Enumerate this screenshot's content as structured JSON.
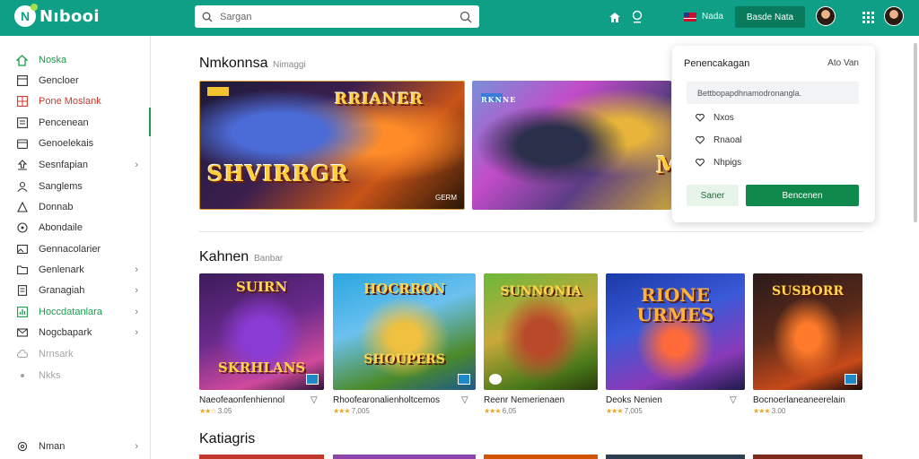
{
  "header": {
    "logo_text": "Nıbooi",
    "logo_letter": "N",
    "search_placeholder": "Sargan",
    "notif_label": "",
    "flag_text": "Nada",
    "cta_label": "Basde Nata"
  },
  "sidebar": {
    "items": [
      {
        "label": "Noska",
        "icon": "home-icon",
        "style": "green"
      },
      {
        "label": "Gencloer",
        "icon": "grid-icon",
        "style": ""
      },
      {
        "label": "Pone Moslank",
        "icon": "table-icon",
        "style": "red"
      },
      {
        "label": "Pencenean",
        "icon": "list-icon",
        "style": ""
      },
      {
        "label": "Genoelekais",
        "icon": "box-icon",
        "style": ""
      },
      {
        "label": "Sesnfapian",
        "icon": "upload-icon",
        "style": "",
        "chevron": true
      },
      {
        "label": "Sanglems",
        "icon": "users-icon",
        "style": ""
      },
      {
        "label": "Donnab",
        "icon": "triangle-icon",
        "style": ""
      },
      {
        "label": "Abondaile",
        "icon": "circle-icon",
        "style": ""
      },
      {
        "label": "Gennacolarier",
        "icon": "image-icon",
        "style": ""
      },
      {
        "label": "Genlenark",
        "icon": "folder-icon",
        "style": "",
        "chevron": true
      },
      {
        "label": "Granagiah",
        "icon": "doc-icon",
        "style": "",
        "chevron": true
      },
      {
        "label": "Hoccdatanlara",
        "icon": "chart-icon",
        "style": "green",
        "chevron": true
      },
      {
        "label": "Nogcbapark",
        "icon": "mail-icon",
        "style": "",
        "chevron": true
      },
      {
        "label": "Nrnsark",
        "icon": "cloud-icon",
        "style": "faded"
      },
      {
        "label": "Nkks",
        "icon": "dot-icon",
        "style": "faded"
      },
      {
        "label": "Nman",
        "icon": "settings-icon",
        "style": "",
        "chevron": true
      }
    ]
  },
  "sections": {
    "featured_title": "Nmkonnsa",
    "featured_sub": "Nimaggi",
    "recommended_title": "Kahnen",
    "recommended_sub": "Banbar",
    "categories_title": "Katiagris"
  },
  "banners": [
    {
      "title": "SHVIRRGR",
      "subtitle": "RRIANER",
      "badge": "GERM"
    },
    {
      "title": "M",
      "subtitle": "RKNNE"
    }
  ],
  "cards": [
    {
      "art_top": "SUIRN",
      "art_bottom": "SKRHLANS",
      "name": "Naeofeaonfenhiennol",
      "rating": "★★☆",
      "meta": "3.05",
      "has_chevron": true
    },
    {
      "art_top": "HOCRRON",
      "art_bottom": "SHOUPERS",
      "name": "Rhoofearonalienholtcemos",
      "rating": "★★★",
      "meta": "7,005",
      "has_chevron": true
    },
    {
      "art_top": "SUNNONIA",
      "art_bottom": "",
      "name": "Reenr Nemerienaen",
      "rating": "★★★",
      "meta": "6,05",
      "has_chevron": false
    },
    {
      "art_top": "RIONE",
      "art_bottom": "URMES",
      "name": "Deoks Nenien",
      "rating": "★★★",
      "meta": "7,005",
      "has_chevron": true
    },
    {
      "art_top": "SUSBORR",
      "art_bottom": "",
      "name": "Bocnoerlaneaneerelain",
      "rating": "★★★",
      "meta": "3.00",
      "has_chevron": false
    }
  ],
  "popup": {
    "title": "Penencakagan",
    "link": "Ato Van",
    "input_placeholder": "Bettbopapdhnamodronangla.",
    "options": [
      "Nxos",
      "Rnaoal",
      "Nhpigs"
    ],
    "secondary_btn": "Saner",
    "primary_btn": "Bencenen"
  },
  "colors": {
    "header_bg": "#0e9f86",
    "accent_green": "#1a9c4a",
    "primary_btn": "#0f8a4c",
    "danger_text": "#d0382c"
  }
}
